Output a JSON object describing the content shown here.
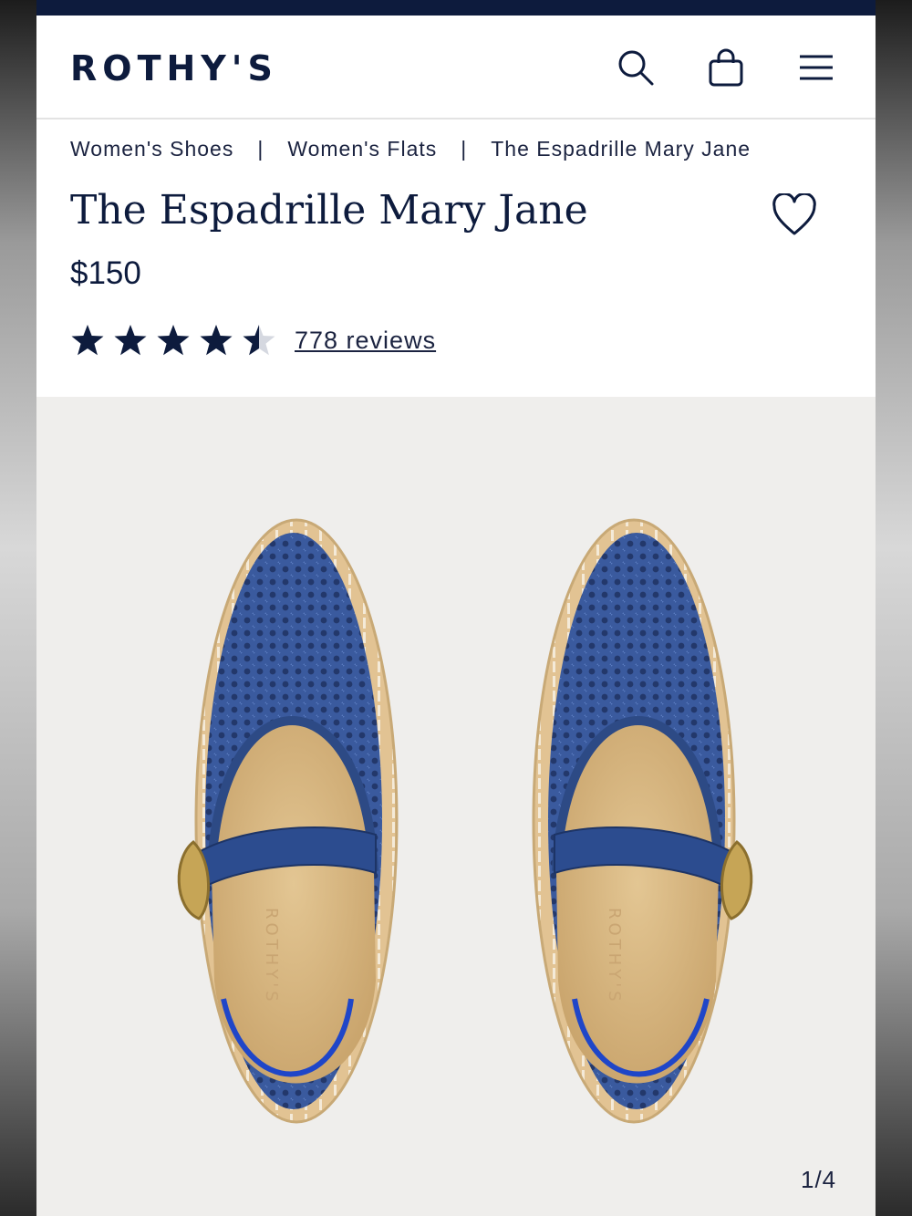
{
  "brand": {
    "logo": "ROTHY'S"
  },
  "header": {
    "icons": [
      "search-icon",
      "shopping-bag-icon",
      "menu-icon"
    ]
  },
  "breadcrumb": {
    "items": [
      "Women's Shoes",
      "Women's Flats",
      "The Espadrille Mary Jane"
    ],
    "separator": "|"
  },
  "product": {
    "title": "The Espadrille Mary Jane",
    "price": "$150",
    "rating": 4.5,
    "rating_max": 5,
    "reviews_label": "778 reviews",
    "wishlist_icon": "heart-icon"
  },
  "gallery": {
    "counter": "1/4",
    "insole_text": "ROTHY'S"
  },
  "colors": {
    "navy": "#0d1b3d",
    "shoe_blue": "#3a5a9e",
    "insole": "#d9b985",
    "sole": "#e2c393",
    "gallery_bg": "#efeeec"
  }
}
